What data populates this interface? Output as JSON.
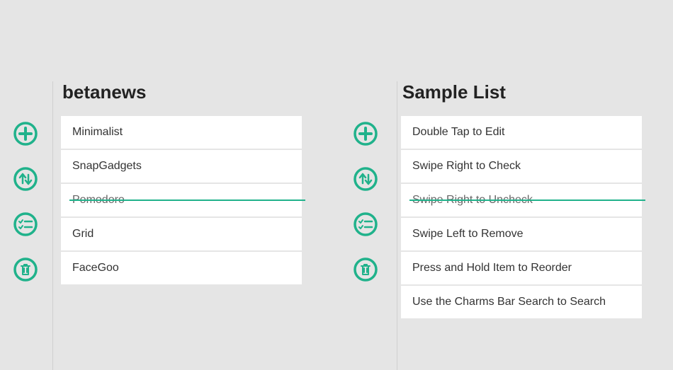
{
  "colors": {
    "accent": "#20b28b"
  },
  "columns": [
    {
      "title": "betanews",
      "items": [
        {
          "label": "Minimalist",
          "checked": false
        },
        {
          "label": "SnapGadgets",
          "checked": false
        },
        {
          "label": "Pomodoro",
          "checked": true
        },
        {
          "label": "Grid",
          "checked": false
        },
        {
          "label": "FaceGoo",
          "checked": false
        }
      ]
    },
    {
      "title": "Sample List",
      "items": [
        {
          "label": "Double Tap to Edit",
          "checked": false
        },
        {
          "label": "Swipe Right to Check",
          "checked": false
        },
        {
          "label": "Swipe Right to Uncheck",
          "checked": true
        },
        {
          "label": "Swipe Left to Remove",
          "checked": false
        },
        {
          "label": "Press and Hold Item to Reorder",
          "checked": false
        },
        {
          "label": "Use the Charms Bar Search to Search",
          "checked": false
        }
      ]
    }
  ],
  "actions": {
    "add": "Add",
    "sort": "Sort",
    "checkall": "Check All",
    "delete": "Delete"
  }
}
